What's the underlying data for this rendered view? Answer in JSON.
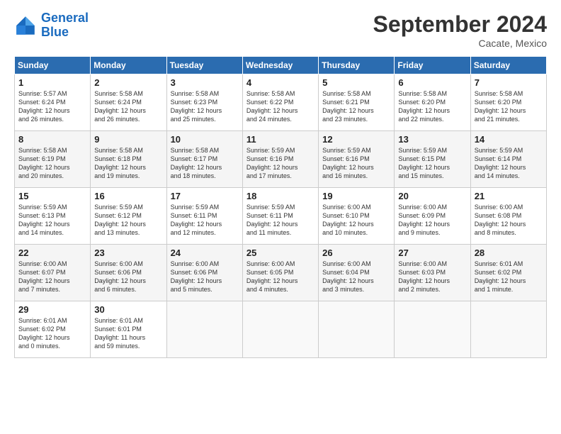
{
  "header": {
    "logo_line1": "General",
    "logo_line2": "Blue",
    "month": "September 2024",
    "location": "Cacate, Mexico"
  },
  "weekdays": [
    "Sunday",
    "Monday",
    "Tuesday",
    "Wednesday",
    "Thursday",
    "Friday",
    "Saturday"
  ],
  "weeks": [
    [
      {
        "day": "1",
        "info": "Sunrise: 5:57 AM\nSunset: 6:24 PM\nDaylight: 12 hours\nand 26 minutes."
      },
      {
        "day": "2",
        "info": "Sunrise: 5:58 AM\nSunset: 6:24 PM\nDaylight: 12 hours\nand 26 minutes."
      },
      {
        "day": "3",
        "info": "Sunrise: 5:58 AM\nSunset: 6:23 PM\nDaylight: 12 hours\nand 25 minutes."
      },
      {
        "day": "4",
        "info": "Sunrise: 5:58 AM\nSunset: 6:22 PM\nDaylight: 12 hours\nand 24 minutes."
      },
      {
        "day": "5",
        "info": "Sunrise: 5:58 AM\nSunset: 6:21 PM\nDaylight: 12 hours\nand 23 minutes."
      },
      {
        "day": "6",
        "info": "Sunrise: 5:58 AM\nSunset: 6:20 PM\nDaylight: 12 hours\nand 22 minutes."
      },
      {
        "day": "7",
        "info": "Sunrise: 5:58 AM\nSunset: 6:20 PM\nDaylight: 12 hours\nand 21 minutes."
      }
    ],
    [
      {
        "day": "8",
        "info": "Sunrise: 5:58 AM\nSunset: 6:19 PM\nDaylight: 12 hours\nand 20 minutes."
      },
      {
        "day": "9",
        "info": "Sunrise: 5:58 AM\nSunset: 6:18 PM\nDaylight: 12 hours\nand 19 minutes."
      },
      {
        "day": "10",
        "info": "Sunrise: 5:58 AM\nSunset: 6:17 PM\nDaylight: 12 hours\nand 18 minutes."
      },
      {
        "day": "11",
        "info": "Sunrise: 5:59 AM\nSunset: 6:16 PM\nDaylight: 12 hours\nand 17 minutes."
      },
      {
        "day": "12",
        "info": "Sunrise: 5:59 AM\nSunset: 6:16 PM\nDaylight: 12 hours\nand 16 minutes."
      },
      {
        "day": "13",
        "info": "Sunrise: 5:59 AM\nSunset: 6:15 PM\nDaylight: 12 hours\nand 15 minutes."
      },
      {
        "day": "14",
        "info": "Sunrise: 5:59 AM\nSunset: 6:14 PM\nDaylight: 12 hours\nand 14 minutes."
      }
    ],
    [
      {
        "day": "15",
        "info": "Sunrise: 5:59 AM\nSunset: 6:13 PM\nDaylight: 12 hours\nand 14 minutes."
      },
      {
        "day": "16",
        "info": "Sunrise: 5:59 AM\nSunset: 6:12 PM\nDaylight: 12 hours\nand 13 minutes."
      },
      {
        "day": "17",
        "info": "Sunrise: 5:59 AM\nSunset: 6:11 PM\nDaylight: 12 hours\nand 12 minutes."
      },
      {
        "day": "18",
        "info": "Sunrise: 5:59 AM\nSunset: 6:11 PM\nDaylight: 12 hours\nand 11 minutes."
      },
      {
        "day": "19",
        "info": "Sunrise: 6:00 AM\nSunset: 6:10 PM\nDaylight: 12 hours\nand 10 minutes."
      },
      {
        "day": "20",
        "info": "Sunrise: 6:00 AM\nSunset: 6:09 PM\nDaylight: 12 hours\nand 9 minutes."
      },
      {
        "day": "21",
        "info": "Sunrise: 6:00 AM\nSunset: 6:08 PM\nDaylight: 12 hours\nand 8 minutes."
      }
    ],
    [
      {
        "day": "22",
        "info": "Sunrise: 6:00 AM\nSunset: 6:07 PM\nDaylight: 12 hours\nand 7 minutes."
      },
      {
        "day": "23",
        "info": "Sunrise: 6:00 AM\nSunset: 6:06 PM\nDaylight: 12 hours\nand 6 minutes."
      },
      {
        "day": "24",
        "info": "Sunrise: 6:00 AM\nSunset: 6:06 PM\nDaylight: 12 hours\nand 5 minutes."
      },
      {
        "day": "25",
        "info": "Sunrise: 6:00 AM\nSunset: 6:05 PM\nDaylight: 12 hours\nand 4 minutes."
      },
      {
        "day": "26",
        "info": "Sunrise: 6:00 AM\nSunset: 6:04 PM\nDaylight: 12 hours\nand 3 minutes."
      },
      {
        "day": "27",
        "info": "Sunrise: 6:00 AM\nSunset: 6:03 PM\nDaylight: 12 hours\nand 2 minutes."
      },
      {
        "day": "28",
        "info": "Sunrise: 6:01 AM\nSunset: 6:02 PM\nDaylight: 12 hours\nand 1 minute."
      }
    ],
    [
      {
        "day": "29",
        "info": "Sunrise: 6:01 AM\nSunset: 6:02 PM\nDaylight: 12 hours\nand 0 minutes."
      },
      {
        "day": "30",
        "info": "Sunrise: 6:01 AM\nSunset: 6:01 PM\nDaylight: 11 hours\nand 59 minutes."
      },
      {
        "day": "",
        "info": ""
      },
      {
        "day": "",
        "info": ""
      },
      {
        "day": "",
        "info": ""
      },
      {
        "day": "",
        "info": ""
      },
      {
        "day": "",
        "info": ""
      }
    ]
  ]
}
